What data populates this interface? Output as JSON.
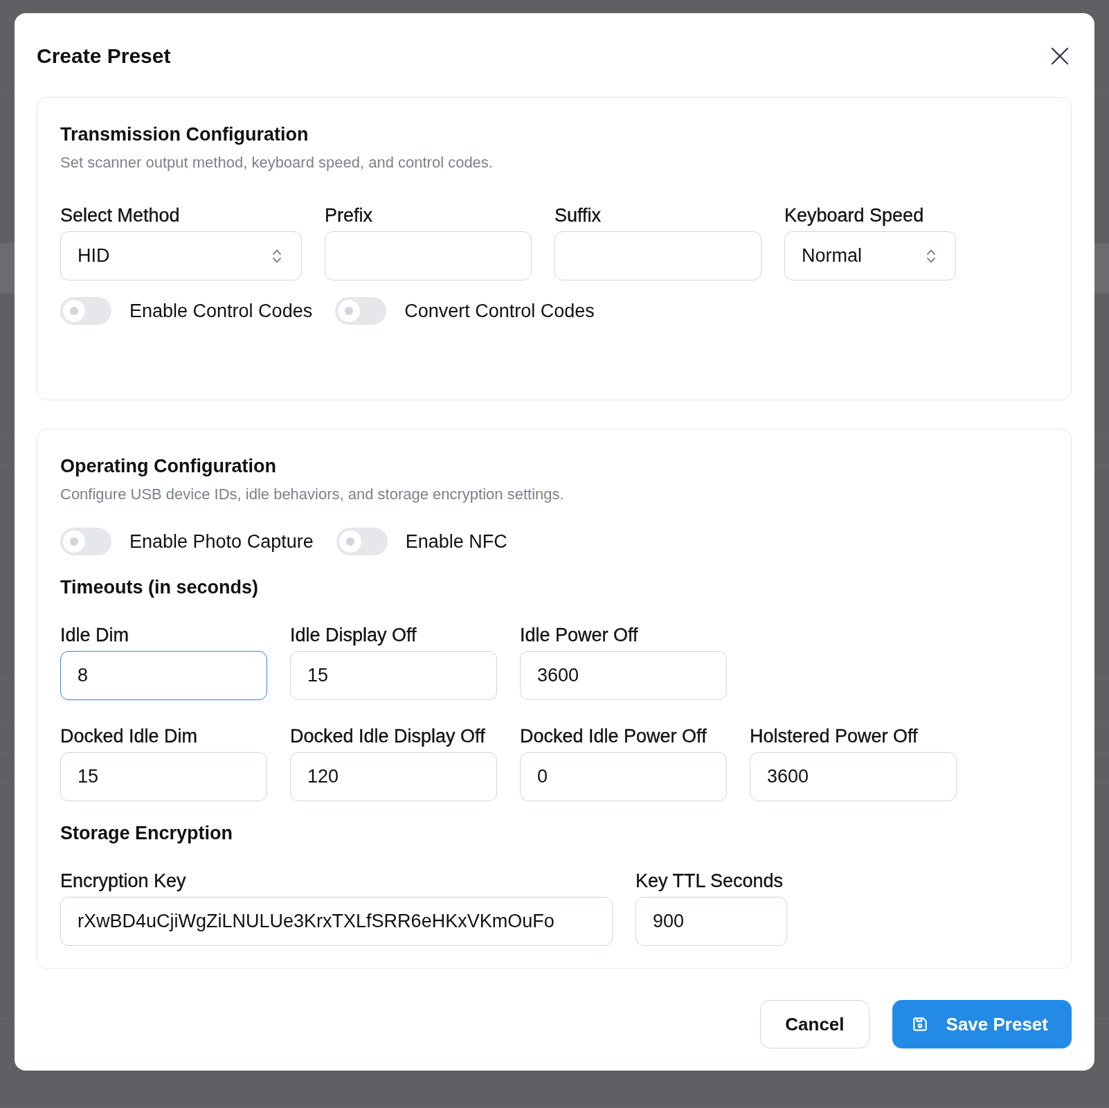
{
  "dialog": {
    "title": "Create Preset"
  },
  "sections": [
    {
      "title": "Transmission Configuration",
      "description": "Set scanner output method, keyboard speed, and control codes.",
      "blocks": [
        {
          "kind": "fields",
          "fields": [
            {
              "kind": "select",
              "label": "Select Method",
              "value": "HID",
              "focused": false
            },
            {
              "kind": "text",
              "label": "Prefix",
              "focused": false
            },
            {
              "kind": "text",
              "label": "Suffix",
              "focused": false
            },
            {
              "kind": "select",
              "label": "Keyboard Speed",
              "value": "Normal",
              "focused": false
            }
          ]
        },
        {
          "kind": "toggles",
          "toggles": [
            {
              "label": "Enable Control Codes",
              "on": false
            },
            {
              "label": "Convert Control Codes",
              "on": false
            }
          ]
        }
      ]
    },
    {
      "title": "Operating Configuration",
      "description": "Configure USB device IDs, idle behaviors, and storage encryption settings.",
      "blocks": [
        {
          "kind": "toggles",
          "toggles": [
            {
              "label": "Enable Photo Capture",
              "on": false
            },
            {
              "label": "Enable NFC",
              "on": false
            }
          ]
        },
        {
          "kind": "heading",
          "text": "Timeouts (in seconds)"
        },
        {
          "kind": "fields",
          "fields": [
            {
              "kind": "text",
              "label": "Idle Dim",
              "value": "8",
              "focused": true
            },
            {
              "kind": "text",
              "label": "Idle Display Off",
              "value": "15",
              "focused": false
            },
            {
              "kind": "text",
              "label": "Idle Power Off",
              "value": "3600",
              "focused": false
            }
          ]
        },
        {
          "kind": "fields",
          "fields": [
            {
              "kind": "text",
              "label": "Docked Idle Dim",
              "value": "15",
              "focused": false
            },
            {
              "kind": "text",
              "label": "Docked Idle Display Off",
              "value": "120",
              "focused": false
            },
            {
              "kind": "text",
              "label": "Docked Idle Power Off",
              "value": "0",
              "focused": false
            },
            {
              "kind": "text",
              "label": "Holstered Power Off",
              "value": "3600",
              "focused": false
            }
          ]
        },
        {
          "kind": "heading",
          "text": "Storage Encryption"
        },
        {
          "kind": "fields",
          "fields": [
            {
              "kind": "text",
              "label": "Encryption Key",
              "value": "rXwBD4uCjiWgZiLNULUe3KrxTXLfSRR6eHKxVKmOuFo",
              "focused": false
            },
            {
              "kind": "text",
              "label": "Key TTL Seconds",
              "value": "900",
              "focused": false
            }
          ]
        }
      ]
    }
  ],
  "buttons": [
    {
      "kind": "cancel",
      "label": "Cancel"
    },
    {
      "kind": "save",
      "label": "Save Preset"
    }
  ]
}
